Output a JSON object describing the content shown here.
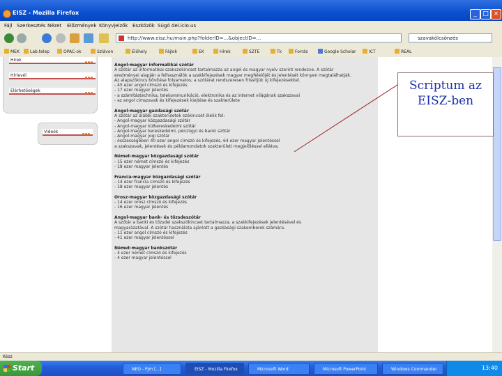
{
  "window": {
    "title": "EISZ - Mozilla Firefox",
    "minimize": "_",
    "maximize": "□",
    "close": "×"
  },
  "menu": [
    "Fájl",
    "Szerkesztés",
    "Nézet",
    "Előzmények",
    "Könyvjelzők",
    "Eszközök",
    "Súgó",
    "del.icio.us"
  ],
  "url": "http://www.eisz.hu/main.php?folderID=...&objectID=...",
  "search_placeholder": "szavakölcsönzés",
  "bookmarks": [
    "MEK",
    "Lab.telep",
    "OPAC-ok",
    "Szlávon",
    "Élőhely",
    "Fájlok",
    "EK",
    "Hírek",
    "SZTE",
    "Tk",
    "Forrás",
    "Google Scholar",
    "ICT",
    "REAL"
  ],
  "sidebar": {
    "items": [
      "Hírek",
      "Hírlevél",
      "Elérhetőségek"
    ],
    "small_item": "Videók"
  },
  "document": {
    "lines": [
      {
        "t": "Angol-magyar informatikai szótár",
        "h": true
      },
      {
        "t": "A szótár az informatikai szakszókincset tartalmazza az angol és magyar nyelv szerint rendezve. A szótár",
        "h": false
      },
      {
        "t": "eredményei alapján a felhasználók a szakkifejezések magyar megfelelőjét és jelentését könnyen megtalálhatják.",
        "h": false
      },
      {
        "t": "Az alapszókincs bővítése folyamatos; a szótárat rendszeresen frissítjük új kifejezésekkel.",
        "h": false
      },
      {
        "t": "- 45 ezer angol címszó és kifejezés",
        "h": false
      },
      {
        "t": "- 17 ezer magyar jelentés",
        "h": false
      },
      {
        "t": "- a számítástechnika, telekommunikáció, elektronika és az internet világának szakszavai",
        "h": false
      },
      {
        "t": "- az angol címszavak és kifejezések kiejtése és szakterülete",
        "h": false
      },
      {
        "t": "",
        "h": false
      },
      {
        "t": "Angol-magyar gazdasági szótár",
        "h": true
      },
      {
        "t": "A szótár az alábbi szakterületek szókincsét ölelik fel:",
        "h": false
      },
      {
        "t": "- Angol-magyar közgazdasági szótár",
        "h": false
      },
      {
        "t": "- Angol-magyar külkereskedelmi szótár",
        "h": false
      },
      {
        "t": "- Angol-magyar kereskedelmi, pénzügyi és banki szótár",
        "h": false
      },
      {
        "t": "- Angol-magyar jogi szótár",
        "h": false
      },
      {
        "t": "- összességében 40 ezer angol címszó és kifejezés, 64 ezer magyar jelentéssel",
        "h": false
      },
      {
        "t": "  a szakszavak, jelentések és példamondatok szakterületi megjelöléssel ellátva.",
        "h": false
      },
      {
        "t": "",
        "h": false
      },
      {
        "t": "Német-magyar közgazdasági szótár",
        "h": true
      },
      {
        "t": "- 15 ezer német címszó és kifejezés",
        "h": false
      },
      {
        "t": "- 18 ezer magyar jelentés",
        "h": false
      },
      {
        "t": "",
        "h": false
      },
      {
        "t": "Francia-magyar közgazdasági szótár",
        "h": true
      },
      {
        "t": "- 14 ezer francia címszó és kifejezés",
        "h": false
      },
      {
        "t": "- 18 ezer magyar jelentés",
        "h": false
      },
      {
        "t": "",
        "h": false
      },
      {
        "t": "Orosz-magyar közgazdasági szótár",
        "h": true
      },
      {
        "t": "- 14 ezer orosz címszó és kifejezés",
        "h": false
      },
      {
        "t": "- 16 ezer magyar jelentés",
        "h": false
      },
      {
        "t": "",
        "h": false
      },
      {
        "t": "Angol-magyar bank- és tőzsdeszótár",
        "h": true
      },
      {
        "t": "A szótár a banki és tőzsdei szakszókincset tartalmazza, a szakkifejezések jelentésével és",
        "h": false
      },
      {
        "t": "magyarázatával. A szótár használata ajánlott a gazdasági szakemberek számára.",
        "h": false
      },
      {
        "t": "- 11 ezer angol címszó és kifejezés",
        "h": false
      },
      {
        "t": "- 41 ezer magyar jelentéssel",
        "h": false
      },
      {
        "t": "",
        "h": false
      },
      {
        "t": "Német-magyar bankszótár",
        "h": true
      },
      {
        "t": "- 4 ezer német címszó és kifejezés",
        "h": false
      },
      {
        "t": "- 4 ezer magyar jelentéssel",
        "h": false
      }
    ]
  },
  "status": "Kész",
  "taskbar": {
    "start": "Start",
    "tasks": [
      "NEO - Pjm [...]",
      "EISZ - Mozilla Firefox",
      "Microsoft Word",
      "Microsoft PowerPoint",
      "Windows Commander"
    ],
    "clock": "13:40"
  },
  "callout": {
    "text": "Scriptum az EISZ-ben"
  }
}
